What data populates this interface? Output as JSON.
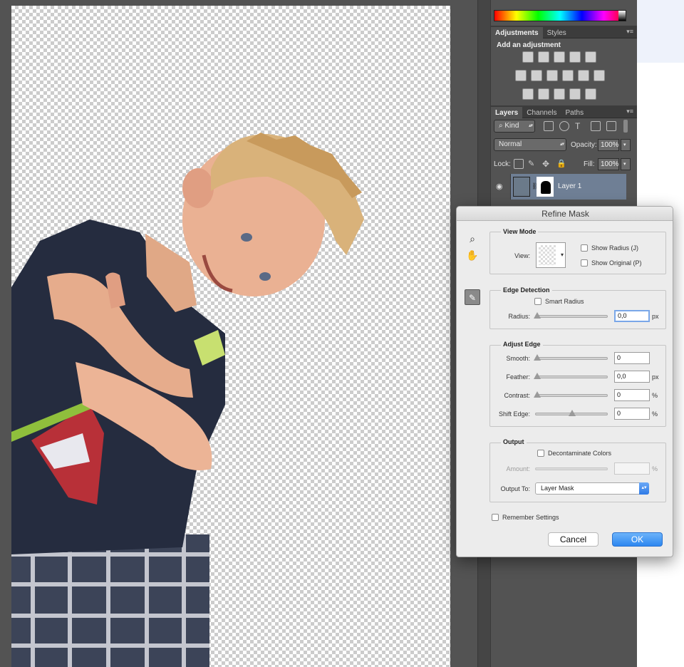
{
  "colors": {
    "workspace": "#535353",
    "panel": "#535353",
    "selected_layer": "#6f7f95",
    "dialog_bg": "#ececec",
    "ok_button": "#2d87f0"
  },
  "adjustments_panel": {
    "tabs": [
      "Adjustments",
      "Styles"
    ],
    "heading": "Add an adjustment",
    "menu_icon": "panel-menu-icon"
  },
  "layers_panel": {
    "tabs": [
      "Layers",
      "Channels",
      "Paths"
    ],
    "filter_kind": "Kind",
    "blend_mode": "Normal",
    "opacity_label": "Opacity:",
    "opacity_value": "100%",
    "lock_label": "Lock:",
    "fill_label": "Fill:",
    "fill_value": "100%",
    "layer_name": "Layer 1"
  },
  "dialog": {
    "title": "Refine Mask",
    "view_mode": {
      "title": "View Mode",
      "view_label": "View:",
      "show_radius": "Show Radius (J)",
      "show_original": "Show Original (P)"
    },
    "edge_detection": {
      "title": "Edge Detection",
      "smart_radius": "Smart Radius",
      "radius_label": "Radius:",
      "radius_value": "0,0",
      "radius_unit": "px"
    },
    "adjust_edge": {
      "title": "Adjust Edge",
      "smooth_label": "Smooth:",
      "smooth_value": "0",
      "feather_label": "Feather:",
      "feather_value": "0,0",
      "feather_unit": "px",
      "contrast_label": "Contrast:",
      "contrast_value": "0",
      "contrast_unit": "%",
      "shift_edge_label": "Shift Edge:",
      "shift_edge_value": "0",
      "shift_edge_unit": "%"
    },
    "output": {
      "title": "Output",
      "decontaminate": "Decontaminate Colors",
      "amount_label": "Amount:",
      "amount_unit": "%",
      "output_to_label": "Output To:",
      "output_to_value": "Layer Mask"
    },
    "remember_settings": "Remember Settings",
    "cancel_label": "Cancel",
    "ok_label": "OK"
  }
}
